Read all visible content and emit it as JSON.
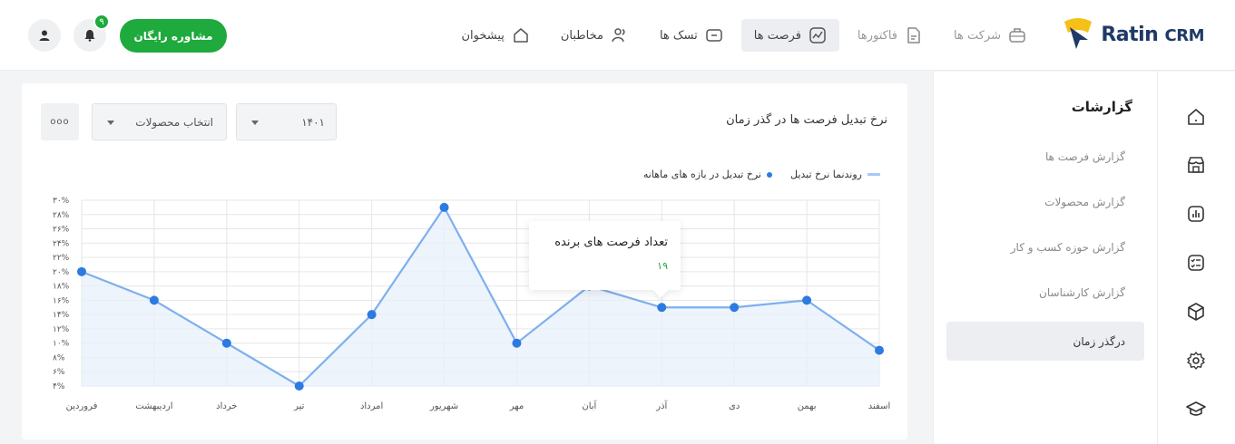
{
  "brand": {
    "name_main": "Ratin",
    "name_suffix": "CRM"
  },
  "nav": {
    "items": [
      {
        "label": "پیشخوان",
        "icon": "home-icon",
        "active": false,
        "dim": false
      },
      {
        "label": "مخاطبان",
        "icon": "users-icon",
        "active": false,
        "dim": false
      },
      {
        "label": "تسک ها",
        "icon": "folder-icon",
        "active": false,
        "dim": false
      },
      {
        "label": "فرصت ها",
        "icon": "chart-trend-icon",
        "active": true,
        "dim": false
      },
      {
        "label": "فاکتورها",
        "icon": "document-icon",
        "active": false,
        "dim": true
      },
      {
        "label": "شرکت ها",
        "icon": "briefcase-icon",
        "active": false,
        "dim": true
      }
    ]
  },
  "header": {
    "cta_label": "مشاوره رایگان",
    "notification_count": "۹"
  },
  "sidebar": {
    "title": "گزارشات",
    "items": [
      {
        "label": "گزارش فرصت ها",
        "active": false
      },
      {
        "label": "گزارش محصولات",
        "active": false
      },
      {
        "label": "گزارش حوزه کسب و کار",
        "active": false
      },
      {
        "label": "گزارش کارشناسان",
        "active": false
      },
      {
        "label": "درگذر زمان",
        "active": true
      }
    ]
  },
  "rail": {
    "icons": [
      "home-icon",
      "store-icon",
      "bar-chart-icon",
      "checklist-icon",
      "box-icon",
      "gear-icon",
      "graduation-cap-icon"
    ]
  },
  "report": {
    "title": "نرخ تبدیل فرصت ها در گذر زمان",
    "year_select": "۱۴۰۱",
    "product_select": "انتخاب محصولات",
    "more_label": "ooo"
  },
  "tooltip": {
    "title": "تعداد فرصت های برنده",
    "value": "۱۹"
  },
  "chart_data": {
    "type": "area",
    "categories": [
      "فروردین",
      "اردیبهشت",
      "خرداد",
      "تیر",
      "امرداد",
      "شهریور",
      "مهر",
      "آبان",
      "آذر",
      "دی",
      "بهمن",
      "اسفند"
    ],
    "series": [
      {
        "name": "نرخ تبدیل در بازه های ماهانه",
        "values": [
          20,
          16,
          10,
          4,
          14,
          29,
          10,
          18,
          15,
          15,
          16,
          9
        ]
      }
    ],
    "legend": [
      {
        "label": "روندنما نرخ تبدیل",
        "style": "line"
      },
      {
        "label": "نرخ تبدیل در بازه های ماهانه",
        "style": "dot"
      }
    ],
    "y_ticks": [
      "۴%",
      "۶%",
      "۸%",
      "۱۰%",
      "۱۲%",
      "۱۴%",
      "۱۶%",
      "۱۸%",
      "۲۰%",
      "۲۲%",
      "۲۴%",
      "۲۶%",
      "۲۸%",
      "۳۰%"
    ],
    "ylim": [
      4,
      30
    ],
    "grid": true,
    "colors": {
      "line": "#7eb0ee",
      "dot": "#2d7be0",
      "fill": "#e8f0fb"
    }
  }
}
